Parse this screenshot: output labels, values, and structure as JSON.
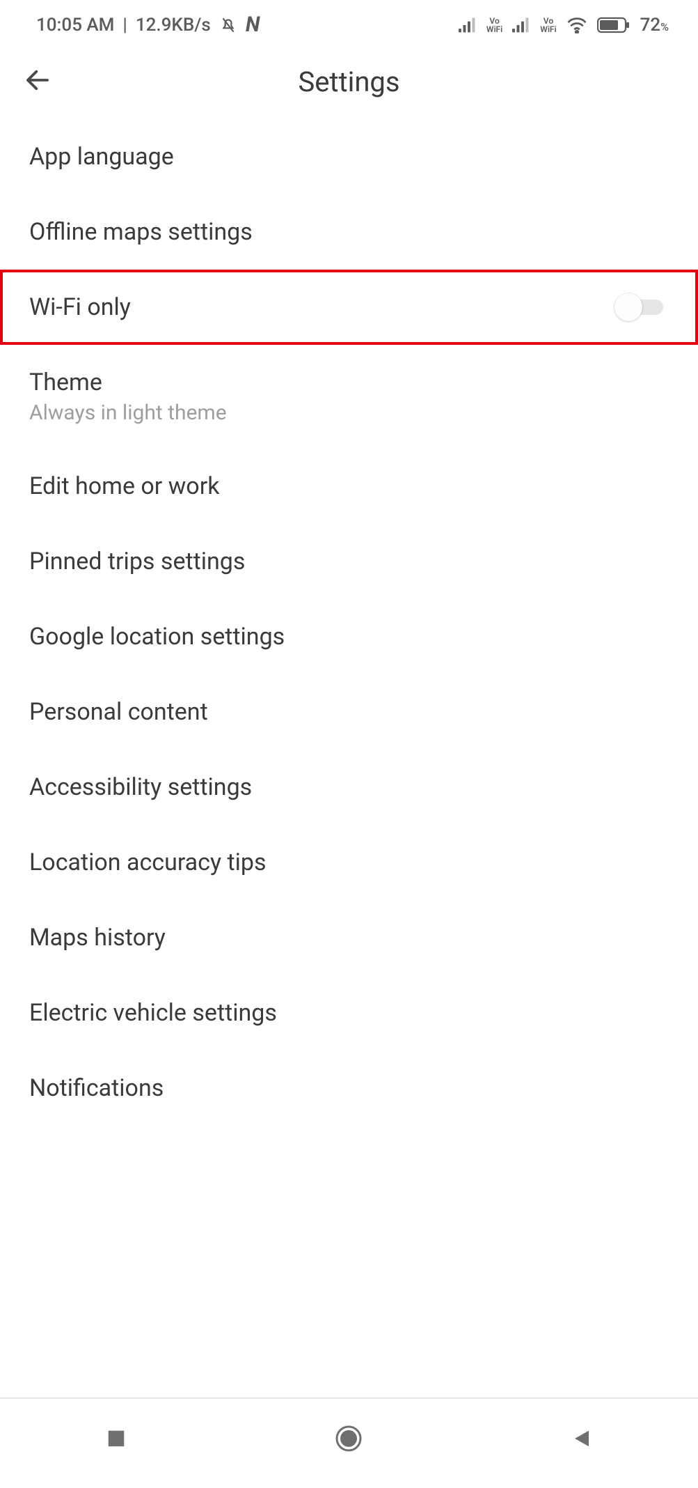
{
  "status": {
    "time": "10:05 AM",
    "data_rate": "12.9KB/s",
    "vowifi_label_top": "Vo",
    "vowifi_label_bottom": "WiFi",
    "battery_pct": "72",
    "battery_pct_suffix": "%"
  },
  "header": {
    "title": "Settings"
  },
  "items": {
    "0": {
      "label": "App language"
    },
    "1": {
      "label": "Offline maps settings"
    },
    "2": {
      "label": "Wi-Fi only",
      "toggle_on": false
    },
    "3": {
      "label": "Theme",
      "sub": "Always in light theme"
    },
    "4": {
      "label": "Edit home or work"
    },
    "5": {
      "label": "Pinned trips settings"
    },
    "6": {
      "label": "Google location settings"
    },
    "7": {
      "label": "Personal content"
    },
    "8": {
      "label": "Accessibility settings"
    },
    "9": {
      "label": "Location accuracy tips"
    },
    "10": {
      "label": "Maps history"
    },
    "11": {
      "label": "Electric vehicle settings"
    },
    "12": {
      "label": "Notifications"
    }
  }
}
